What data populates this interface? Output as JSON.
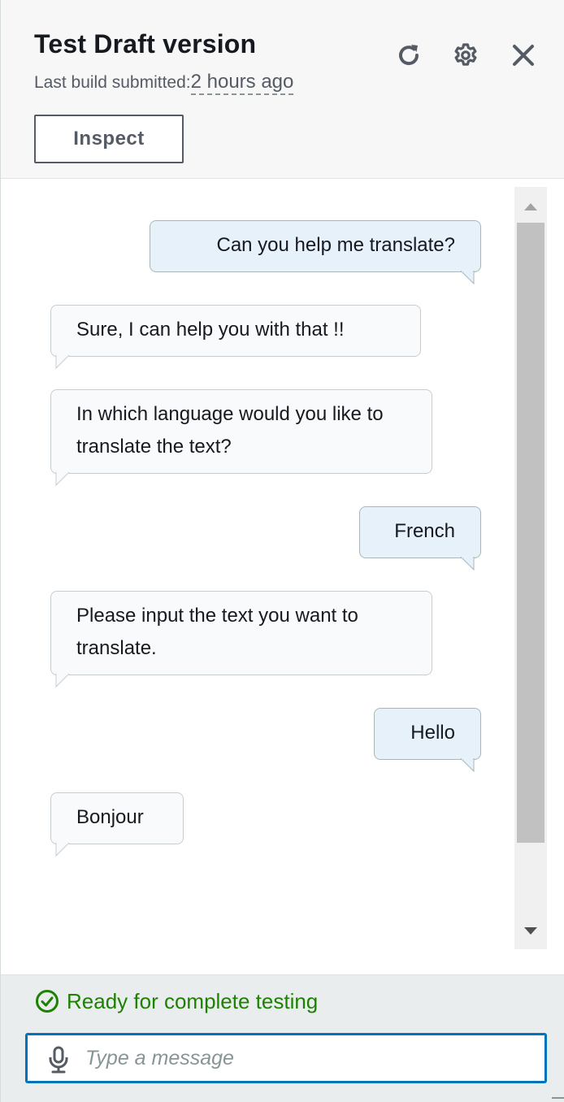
{
  "header": {
    "title": "Test Draft version",
    "subtitle_prefix": "Last build submitted:",
    "subtitle_time": "2 hours ago",
    "inspect_label": "Inspect",
    "icons": [
      "refresh-icon",
      "settings-icon",
      "close-icon"
    ]
  },
  "conversation": {
    "messages": [
      {
        "sender": "user",
        "text": "Can you help me translate?"
      },
      {
        "sender": "bot",
        "text": "Sure, I can help you with that !!"
      },
      {
        "sender": "bot",
        "text": "In which language would you like to translate the text?"
      },
      {
        "sender": "user",
        "text": "French"
      },
      {
        "sender": "bot",
        "text": "Please input the text you want to translate."
      },
      {
        "sender": "user",
        "text": "Hello"
      },
      {
        "sender": "bot",
        "text": "Bonjour"
      }
    ]
  },
  "footer": {
    "status_text": "Ready for complete testing",
    "input_placeholder": "Type a message",
    "input_value": ""
  },
  "colors": {
    "status_green": "#1d8102",
    "focus_blue": "#0073bb",
    "user_bubble": "#e6f1fa",
    "bot_bubble": "#f9fafb"
  }
}
